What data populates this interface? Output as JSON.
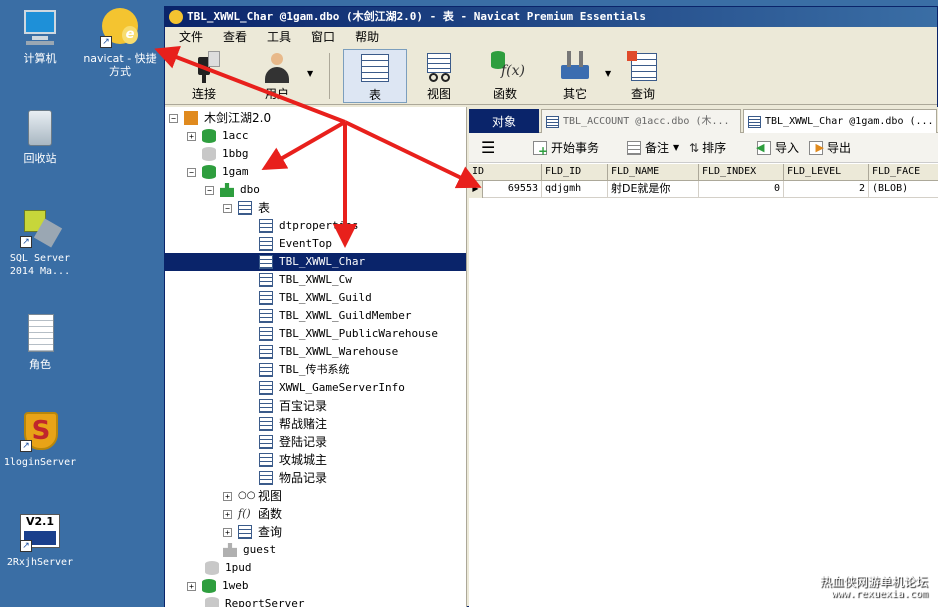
{
  "desktop": {
    "icons": [
      {
        "label": "计算机"
      },
      {
        "label": "navicat - 快捷方式"
      },
      {
        "label": "回收站"
      },
      {
        "label": "SQL Server 2014 Ma..."
      },
      {
        "label": "角色"
      },
      {
        "label": "1loginServer"
      },
      {
        "label": "2RxjhServer"
      }
    ],
    "v24_badge": "V2.1"
  },
  "window": {
    "title": "TBL_XWWL_Char @1gam.dbo (木剑江湖2.0) - 表 - Navicat Premium Essentials",
    "menu": [
      "文件",
      "查看",
      "工具",
      "窗口",
      "帮助"
    ],
    "toolbar": {
      "connect": "连接",
      "user": "用户",
      "table": "表",
      "view": "视图",
      "function": "函数",
      "other": "其它",
      "query": "查询"
    }
  },
  "tree": {
    "connection": "木剑江湖2.0",
    "db_1acc": "1acc",
    "db_1bbg": "1bbg",
    "db_1gam": "1gam",
    "schema_dbo": "dbo",
    "tables_folder": "表",
    "tables": [
      "dtproperties",
      "EventTop",
      "TBL_XWWL_Char",
      "TBL_XWWL_Cw",
      "TBL_XWWL_Guild",
      "TBL_XWWL_GuildMember",
      "TBL_XWWL_PublicWarehouse",
      "TBL_XWWL_Warehouse",
      "TBL_传书系统",
      "XWWL_GameServerInfo",
      "百宝记录",
      "帮战赌注",
      "登陆记录",
      "攻城城主",
      "物品记录"
    ],
    "views": "视图",
    "functions": "函数",
    "queries": "查询",
    "guest": "guest",
    "db_1pud": "1pud",
    "db_1web": "1web",
    "db_report": "ReportServer"
  },
  "right": {
    "tabs": {
      "objects": "对象",
      "account": "TBL_ACCOUNT @1acc.dbo (木...",
      "char": "TBL_XWWL_Char @1gam.dbo (..."
    },
    "subtoolbar": {
      "begin_tx": "开始事务",
      "memo": "备注",
      "sort": "排序",
      "import": "导入",
      "export": "导出"
    },
    "columns": [
      "ID",
      "FLD_ID",
      "FLD_NAME",
      "FLD_INDEX",
      "FLD_LEVEL",
      "FLD_FACE"
    ],
    "rows": [
      {
        "id": "69553",
        "fld_id": "qdjgmh",
        "fld_name": "射DE就是你",
        "fld_index": "0",
        "fld_level": "2",
        "fld_face": "(BLOB)"
      }
    ]
  },
  "watermark": {
    "cn": "热血侠网游单机论坛",
    "url": "www.rexuexia.com"
  },
  "colors": {
    "desktop": "#3a6ea5",
    "selection": "#0a246a",
    "arrow": "#e8201c"
  }
}
